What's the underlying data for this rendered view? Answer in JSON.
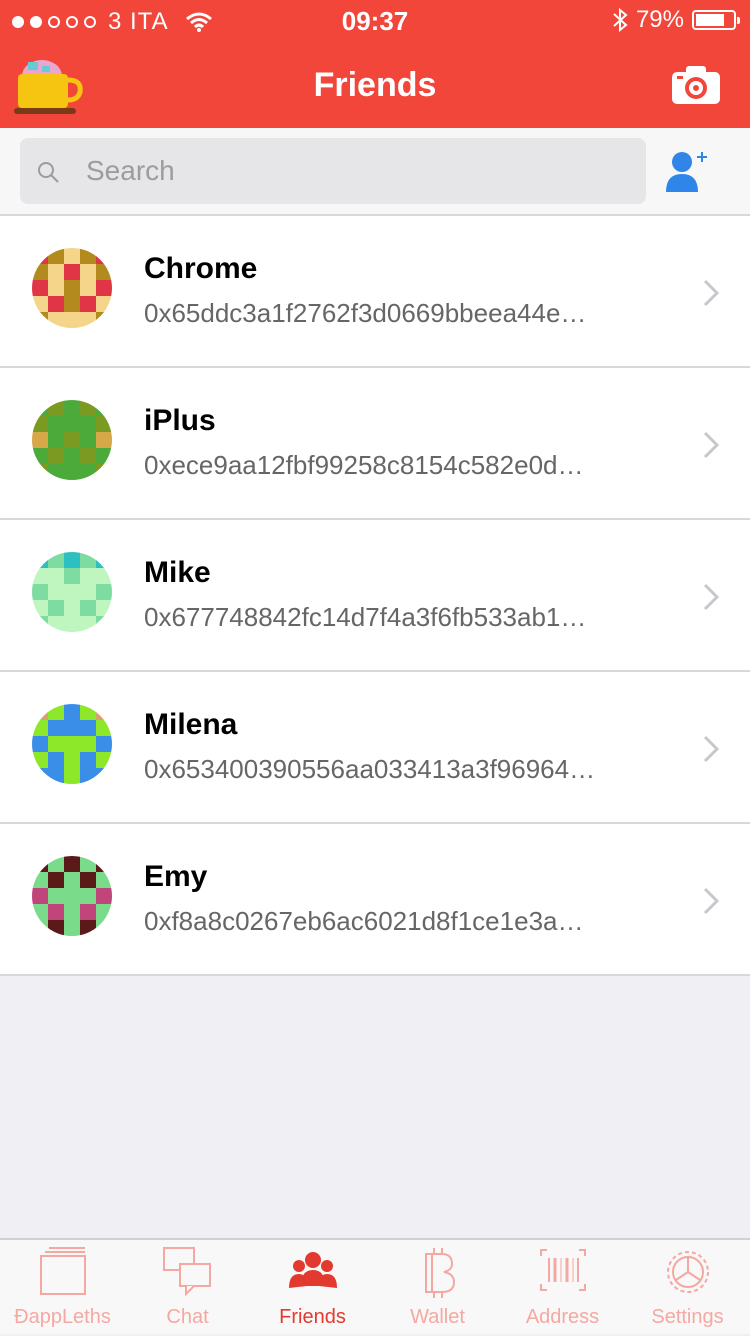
{
  "status_bar": {
    "carrier": "3 ITA",
    "time": "09:37",
    "battery": "79%",
    "battery_level": 0.79
  },
  "nav": {
    "title": "Friends",
    "left_icon": "mug-icon",
    "right_icon": "camera-icon"
  },
  "search": {
    "placeholder": "Search",
    "value": ""
  },
  "friends": [
    {
      "name": "Chrome",
      "address": "0x65ddc3a1f2762f3d0669bbeea44e…",
      "colors": [
        "#e03545",
        "#b38a1e",
        "#f5d58a"
      ]
    },
    {
      "name": "iPlus",
      "address": "0xece9aa12fbf99258c8154c582e0d…",
      "colors": [
        "#4caa3a",
        "#7a9a22",
        "#d6a847"
      ]
    },
    {
      "name": "Mike",
      "address": "0x677748842fc14d7f4a3f6fb533ab1…",
      "colors": [
        "#bff5bf",
        "#7fdca0",
        "#2cc0c0"
      ]
    },
    {
      "name": "Milena",
      "address": "0x653400390556aa033413a3f96964…",
      "colors": [
        "#8ee82a",
        "#3a8ee8",
        "#d8a070"
      ]
    },
    {
      "name": "Emy",
      "address": "0xf8a8c0267eb6ac6021d8f1ce1e3a…",
      "colors": [
        "#7adb8a",
        "#c0457a",
        "#5a1a1a"
      ]
    }
  ],
  "tabs": [
    {
      "label": "ÐappLeths",
      "icon": "dapp-icon",
      "active": false
    },
    {
      "label": "Chat",
      "icon": "chat-icon",
      "active": false
    },
    {
      "label": "Friends",
      "icon": "friends-icon",
      "active": true
    },
    {
      "label": "Wallet",
      "icon": "bitcoin-icon",
      "active": false
    },
    {
      "label": "Address",
      "icon": "barcode-icon",
      "active": false
    },
    {
      "label": "Settings",
      "icon": "gear-icon",
      "active": false
    }
  ],
  "colors": {
    "accent": "#f2463a",
    "tab_inactive": "#f5a8a2",
    "tab_active": "#e23a2f"
  }
}
